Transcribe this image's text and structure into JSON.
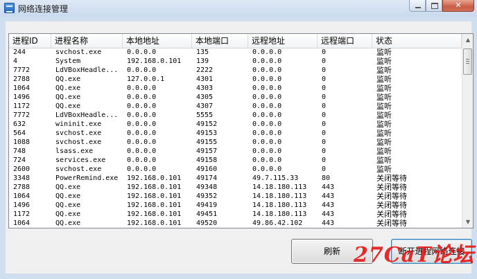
{
  "window": {
    "title": "网络连接管理",
    "app_icon": "network-app-icon",
    "controls": {
      "minimize": "minimize",
      "maximize": "maximize",
      "close": "✕"
    }
  },
  "table": {
    "columns": [
      "进程ID",
      "进程名称",
      "本地地址",
      "本地端口",
      "远程地址",
      "远程端口",
      "状态"
    ],
    "rows": [
      [
        "244",
        "svchost.exe",
        "0.0.0.0",
        "135",
        "0.0.0.0",
        "0",
        "监听"
      ],
      [
        "4",
        "System",
        "192.168.0.101",
        "139",
        "0.0.0.0",
        "0",
        "监听"
      ],
      [
        "7772",
        "LdVBoxHeadle...",
        "0.0.0.0",
        "2222",
        "0.0.0.0",
        "0",
        "监听"
      ],
      [
        "2788",
        "QQ.exe",
        "127.0.0.1",
        "4301",
        "0.0.0.0",
        "0",
        "监听"
      ],
      [
        "1064",
        "QQ.exe",
        "0.0.0.0",
        "4303",
        "0.0.0.0",
        "0",
        "监听"
      ],
      [
        "1496",
        "QQ.exe",
        "0.0.0.0",
        "4305",
        "0.0.0.0",
        "0",
        "监听"
      ],
      [
        "1172",
        "QQ.exe",
        "0.0.0.0",
        "4307",
        "0.0.0.0",
        "0",
        "监听"
      ],
      [
        "7772",
        "LdVBoxHeadle...",
        "0.0.0.0",
        "5555",
        "0.0.0.0",
        "0",
        "监听"
      ],
      [
        "632",
        "wininit.exe",
        "0.0.0.0",
        "49152",
        "0.0.0.0",
        "0",
        "监听"
      ],
      [
        "564",
        "svchost.exe",
        "0.0.0.0",
        "49153",
        "0.0.0.0",
        "0",
        "监听"
      ],
      [
        "1088",
        "svchost.exe",
        "0.0.0.0",
        "49155",
        "0.0.0.0",
        "0",
        "监听"
      ],
      [
        "748",
        "lsass.exe",
        "0.0.0.0",
        "49157",
        "0.0.0.0",
        "0",
        "监听"
      ],
      [
        "724",
        "services.exe",
        "0.0.0.0",
        "49158",
        "0.0.0.0",
        "0",
        "监听"
      ],
      [
        "2600",
        "svchost.exe",
        "0.0.0.0",
        "49160",
        "0.0.0.0",
        "0",
        "监听"
      ],
      [
        "3348",
        "PowerRemind.exe",
        "192.168.0.101",
        "49174",
        "49.7.115.33",
        "80",
        "关闭等待"
      ],
      [
        "2788",
        "QQ.exe",
        "192.168.0.101",
        "49348",
        "14.18.180.113",
        "443",
        "关闭等待"
      ],
      [
        "1064",
        "QQ.exe",
        "192.168.0.101",
        "49352",
        "14.18.180.113",
        "443",
        "关闭等待"
      ],
      [
        "1496",
        "QQ.exe",
        "192.168.0.101",
        "49419",
        "14.18.180.113",
        "443",
        "关闭等待"
      ],
      [
        "1172",
        "QQ.exe",
        "192.168.0.101",
        "49451",
        "14.18.180.113",
        "443",
        "关闭等待"
      ],
      [
        "1064",
        "QQ.exe",
        "192.168.0.101",
        "49520",
        "49.86.42.102",
        "443",
        "关闭等待"
      ]
    ]
  },
  "scrollbar": {
    "up_icon": "▲",
    "down_icon": "▼"
  },
  "buttons": {
    "refresh": "刷新",
    "disconnect": "断开进程网络连接"
  },
  "watermark": "27CaT论坛"
}
